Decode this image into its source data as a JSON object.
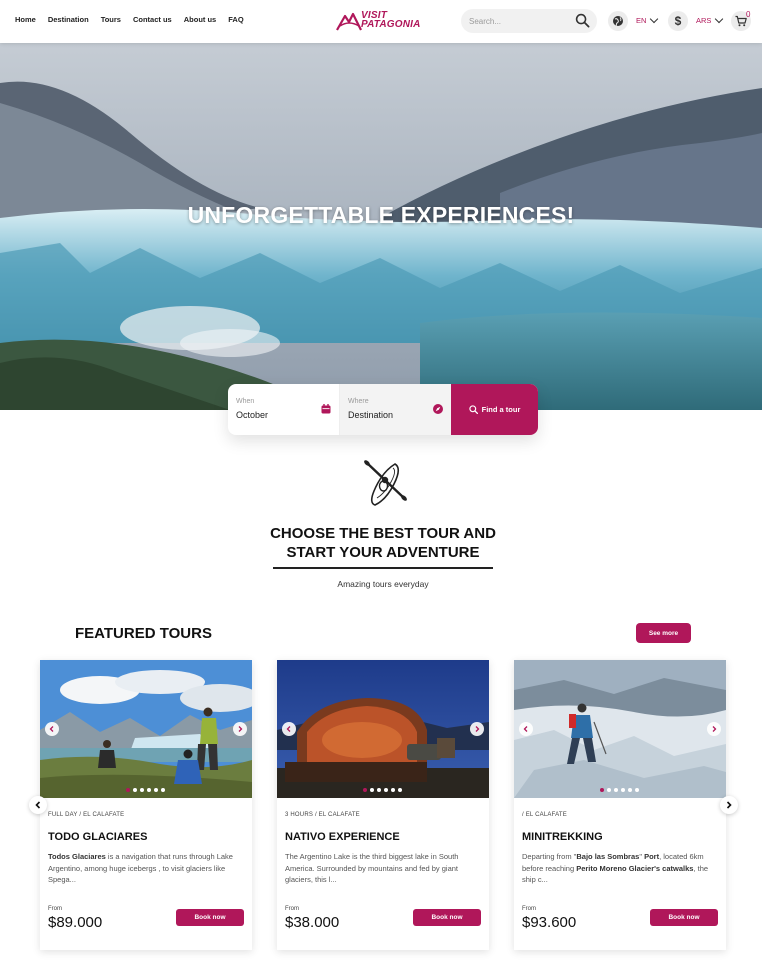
{
  "header": {
    "nav": [
      "Home",
      "Destination",
      "Tours",
      "Contact us",
      "About us",
      "FAQ"
    ],
    "logo_line1": "VISIT",
    "logo_line2": "PATAGONIA",
    "search_placeholder": "Search...",
    "language": "EN",
    "currency": "ARS",
    "cart_count": "0"
  },
  "hero": {
    "title": "UNFORGETTABLE EXPERIENCES!"
  },
  "booking": {
    "when_label": "When",
    "when_value": "October",
    "where_label": "Where",
    "where_value": "Destination",
    "button": "Find a tour"
  },
  "intro": {
    "title_line1": "CHOOSE THE BEST TOUR AND",
    "title_line2": "START YOUR ADVENTURE",
    "subtitle": "Amazing tours everyday"
  },
  "featured": {
    "title": "FEATURED TOURS",
    "see_more": "See more"
  },
  "tours": [
    {
      "meta": "FULL DAY / EL CALAFATE",
      "title": "TODO GLACIARES",
      "desc_bold": "Todos Glaciares",
      "desc": " is a navigation that runs through Lake Argentino, among huge icebergs , to visit glaciers like Spega...",
      "from": "From",
      "price": "$89.000",
      "button": "Book now"
    },
    {
      "meta": "3 HOURS / EL CALAFATE",
      "title": "NATIVO EXPERIENCE",
      "desc": "The Argentino Lake is the third biggest lake in South America. Surrounded by mountains and fed by giant glaciers, this l...",
      "from": "From",
      "price": "$38.000",
      "button": "Book now"
    },
    {
      "meta": "/ EL CALAFATE",
      "title": "MINITREKKING",
      "desc_pre": "Departing from \"",
      "desc_b1": "Bajo las Sombras",
      "desc_mid1": "\" ",
      "desc_b2": "Port",
      "desc_mid2": ", located 6km before reaching ",
      "desc_b3": "Perito Moreno Glacier's catwalks",
      "desc_post": ", the ship c...",
      "from": "From",
      "price": "$93.600",
      "button": "Book now"
    }
  ],
  "colors": {
    "brand": "#b0175a"
  },
  "icons": [
    "globe-icon",
    "dollar-icon",
    "cart-icon",
    "search-icon",
    "calendar-icon",
    "compass-icon",
    "kayak-icon"
  ]
}
